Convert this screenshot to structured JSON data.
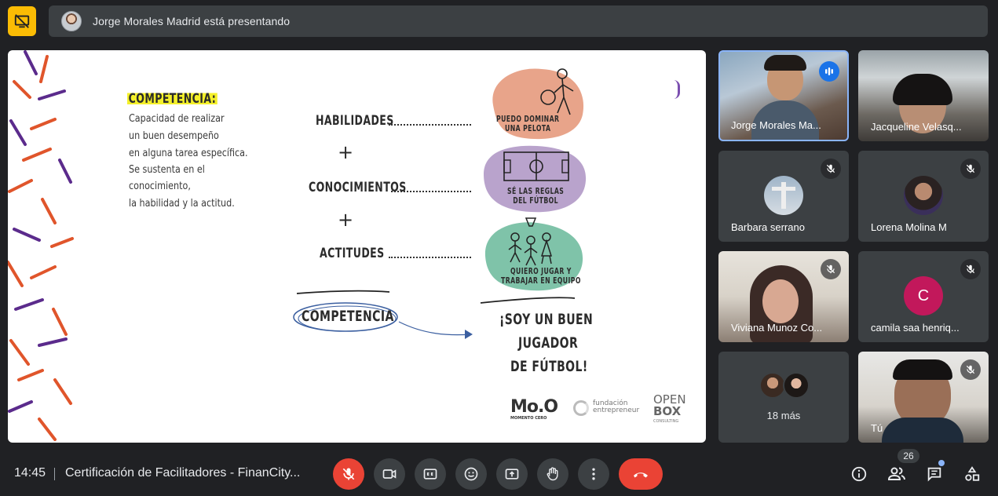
{
  "banner": {
    "presenting_text": "Jorge Morales Madrid está presentando"
  },
  "slide": {
    "title": "COMPETENCIA:",
    "definition_lines": [
      "Capacidad de realizar",
      "un buen desempeño",
      "en alguna tarea específica.",
      "Se sustenta en el",
      "conocimiento,",
      "la habilidad y la actitud."
    ],
    "rows": [
      "HABILIDADES",
      "CONOCIMIENTOS",
      "ACTITUDES"
    ],
    "plus": "+",
    "bubbles": [
      {
        "caption_1": "PUEDO DOMINAR",
        "caption_2": "UNA PELOTA",
        "color": "#e8a48a"
      },
      {
        "caption_1": "SÉ LAS REGLAS",
        "caption_2": "DEL FÚTBOL",
        "color": "#b9a3cc"
      },
      {
        "caption_1": "QUIERO JUGAR Y",
        "caption_2": "TRABAJAR EN EQUIPO",
        "color": "#7fc3a9"
      }
    ],
    "circled_word": "COMPETENCIA",
    "result_lines": [
      "¡SOY UN BUEN",
      "JUGADOR",
      "DE FÚTBOL!"
    ],
    "logos": {
      "moo": "Mo.O",
      "moo_sub": "MOMENTO CERO",
      "fundacion_1": "fundación",
      "fundacion_2": "entrepreneur",
      "openbox_1": "OPEN",
      "openbox_2": "BOX",
      "openbox_3": "CONSULTING"
    }
  },
  "participants": [
    {
      "name": "Jorge Morales Ma...",
      "state": "speaking"
    },
    {
      "name": "Jacqueline Velasq..."
    },
    {
      "name": "Barbara serrano",
      "state": "muted"
    },
    {
      "name": "Lorena Molina M",
      "state": "muted"
    },
    {
      "name": "Viviana Munoz Co...",
      "state": "muted"
    },
    {
      "name": "camila saa henriq...",
      "state": "muted",
      "initial": "C",
      "avatar_color": "#c2185b"
    },
    {
      "more_label": "18 más"
    },
    {
      "name": "Tú",
      "state": "muted"
    }
  ],
  "bottom_bar": {
    "time": "14:45",
    "meeting_title": "Certificación de Facilitadores - FinanCity...",
    "participant_count": "26"
  },
  "colors": {
    "accent_blue": "#1a73e8",
    "danger_red": "#ea4335",
    "present_yellow": "#fbbc04"
  }
}
